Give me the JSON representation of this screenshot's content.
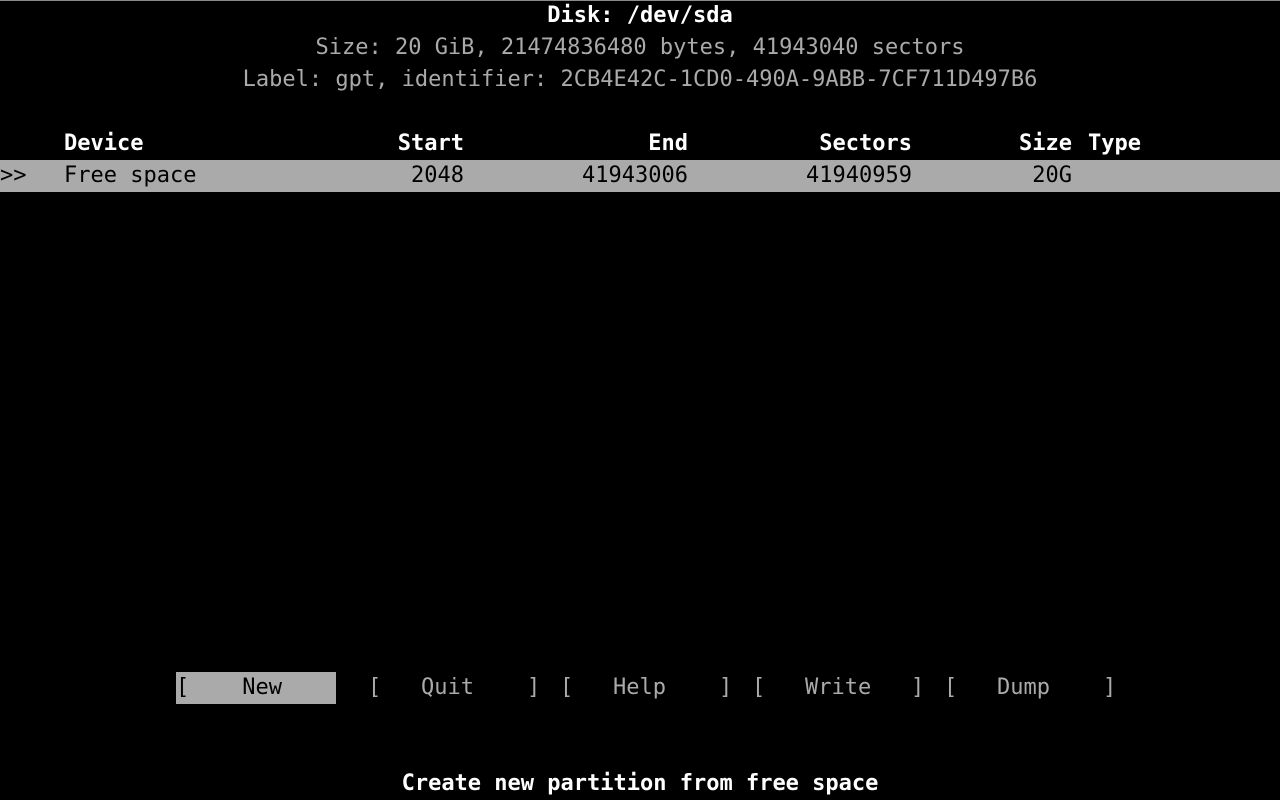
{
  "app": {
    "name": "cfdisk",
    "colors": {
      "background": "#000000",
      "foreground": "#aaaaaa",
      "bright_foreground": "#ffffff",
      "highlight_background": "#aaaaaa",
      "highlight_foreground": "#000000"
    }
  },
  "header": {
    "disk_line": "Disk: /dev/sda",
    "size_line": "Size: 20 GiB, 21474836480 bytes, 41943040 sectors",
    "label_line": "Label: gpt, identifier: 2CB4E42C-1CD0-490A-9ABB-7CF711D497B6",
    "disk_device": "/dev/sda",
    "size_human": "20 GiB",
    "size_bytes": "21474836480",
    "size_sectors": "41943040",
    "label_type": "gpt",
    "identifier": "2CB4E42C-1CD0-490A-9ABB-7CF711D497B6"
  },
  "table": {
    "columns": [
      {
        "key": "device",
        "label": "Device",
        "align": "left"
      },
      {
        "key": "start",
        "label": "Start",
        "align": "right"
      },
      {
        "key": "end",
        "label": "End",
        "align": "right"
      },
      {
        "key": "sectors",
        "label": "Sectors",
        "align": "right"
      },
      {
        "key": "size",
        "label": "Size",
        "align": "right"
      },
      {
        "key": "type",
        "label": "Type",
        "align": "left"
      }
    ],
    "rows": [
      {
        "marker": ">>",
        "device": "Free space",
        "start": "2048",
        "end": "41943006",
        "sectors": "41940959",
        "size": "20G",
        "type": "",
        "selected": true
      }
    ]
  },
  "menu": {
    "buttons": [
      {
        "id": "new",
        "label": "[    New    ]",
        "active": true
      },
      {
        "id": "quit",
        "label": "[   Quit    ]",
        "active": false
      },
      {
        "id": "help",
        "label": "[   Help    ]",
        "active": false
      },
      {
        "id": "write",
        "label": "[   Write   ]",
        "active": false
      },
      {
        "id": "dump",
        "label": "[   Dump    ]",
        "active": false
      }
    ]
  },
  "status": {
    "hint": "Create new partition from free space"
  }
}
